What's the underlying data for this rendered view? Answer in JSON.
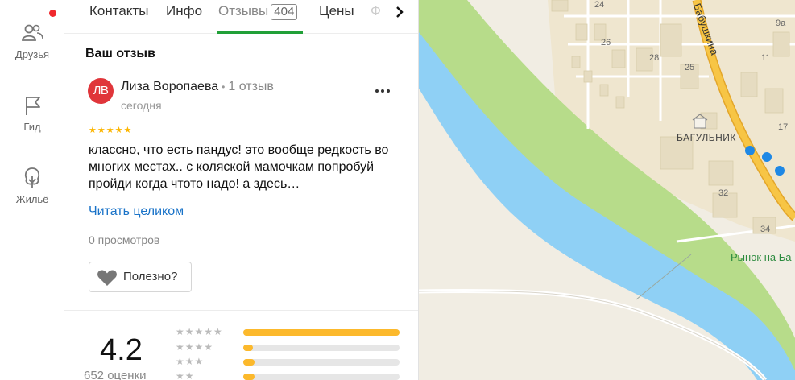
{
  "rail": {
    "items": [
      {
        "label": "Друзья",
        "icon": "friends-icon"
      },
      {
        "label": "Гид",
        "icon": "guide-flag-icon"
      },
      {
        "label": "Жильё",
        "icon": "housing-tree-icon"
      }
    ]
  },
  "tabs": {
    "items": [
      {
        "label": "Контакты"
      },
      {
        "label": "Инфо"
      },
      {
        "label": "Отзывы",
        "count": "404",
        "active": true
      },
      {
        "label": "Цены"
      }
    ],
    "faded_label": "Ф"
  },
  "review": {
    "section_title": "Ваш отзыв",
    "avatar_initials": "ЛВ",
    "author": "Лиза Воропаева",
    "author_reviews": "1 отзыв",
    "date": "сегодня",
    "stars": "★★★★★",
    "text": "классно, что есть пандус! это вообще редкость во многих местах.. с коляской мамочкам попробуй пройди когда чтото надо! а здесь…",
    "read_more": "Читать целиком",
    "views": "0 просмотров",
    "helpful_label": "Полезно?"
  },
  "summary": {
    "rating": "4.2",
    "count_label": "652 оценки",
    "distribution": [
      {
        "stars": "★★★★★",
        "fraction": 1.0
      },
      {
        "stars": "★★★★",
        "fraction": 0.06
      },
      {
        "stars": "★★★",
        "fraction": 0.07
      },
      {
        "stars": "★★",
        "fraction": 0.07
      }
    ]
  },
  "map": {
    "house_numbers": [
      "24",
      "26",
      "28",
      "25",
      "32",
      "34",
      "11",
      "17",
      "9а"
    ],
    "street": "Бабушкина",
    "place": "БАГУЛЬНИК",
    "market": "Рынок на Ба"
  },
  "colors": {
    "accent_green": "#21a038",
    "star_yellow": "#fcb500",
    "link_blue": "#1a73c8",
    "avatar_red": "#e0353a",
    "river": "#8fd0f5",
    "park": "#b7dc8a",
    "road": "#f7c545"
  }
}
